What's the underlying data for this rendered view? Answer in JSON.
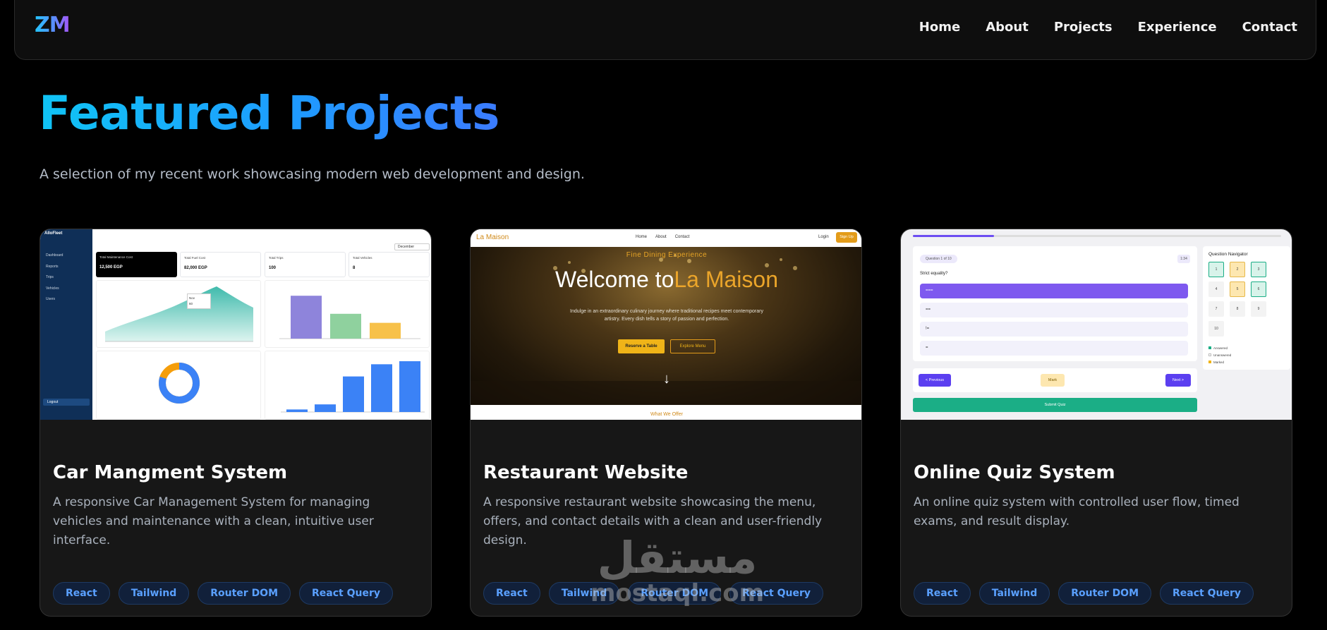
{
  "brand": {
    "logo": "ZM"
  },
  "nav": {
    "items": [
      {
        "label": "Home"
      },
      {
        "label": "About"
      },
      {
        "label": "Projects"
      },
      {
        "label": "Experience"
      },
      {
        "label": "Contact"
      }
    ]
  },
  "header": {
    "title": "Featured Projects",
    "subtitle": "A selection of my recent work showcasing modern web development and design."
  },
  "projects": [
    {
      "title": "Car Mangment System",
      "description": "A responsive Car Management System for managing vehicles and maintenance with a clean, intuitive user interface.",
      "tags": [
        "React",
        "Tailwind",
        "Router DOM",
        "React Query"
      ],
      "preview": {
        "brand": "AlloFleet",
        "sidebar": [
          "Dashboard",
          "Reports",
          "Trips",
          "Vehicles",
          "Users"
        ],
        "logout": "Logout",
        "month": "December",
        "stats": [
          {
            "label": "Total Maintenance Cost",
            "value": "12,500 EGP"
          },
          {
            "label": "Total Fuel Cost",
            "value": "82,000 EGP"
          },
          {
            "label": "Total Trips",
            "value": "100"
          },
          {
            "label": "Total Vehicles",
            "value": "8"
          }
        ],
        "tooltip_title": "Nov",
        "tooltip_value": "60",
        "bar_values": [
          0.95,
          0.55,
          0.35
        ],
        "bar_colors": [
          "#8e84db",
          "#8fd19e",
          "#f7c14a"
        ],
        "column_values": [
          0.05,
          0.15,
          0.7,
          0.94,
          1.0
        ],
        "donut_share": 0.8
      }
    },
    {
      "title": "Restaurant Website",
      "description": "A responsive restaurant website showcasing the menu, offers, and contact details with a clean and user-friendly design.",
      "tags": [
        "React",
        "Tailwind",
        "Router DOM",
        "React Query"
      ],
      "preview": {
        "brand": "La Maison",
        "nav": [
          "Home",
          "About",
          "Contact"
        ],
        "login": "Login",
        "signup": "Sign Up",
        "eyebrow": "Fine Dining Experience",
        "heading_prefix": "Welcome to",
        "heading_highlight": "La Maison",
        "intro": "Indulge in an extraordinary culinary journey where traditional recipes meet contemporary artistry. Every dish tells a story of passion and perfection.",
        "primary_cta": "Reserve a Table",
        "secondary_cta": "Explore Menu",
        "arrow": "↓",
        "footer": "What We Offer"
      }
    },
    {
      "title": "Online Quiz System",
      "description": "An online quiz system with controlled user flow, timed exams, and result display.",
      "tags": [
        "React",
        "Tailwind",
        "Router DOM",
        "React Query"
      ],
      "preview": {
        "progress": 0.22,
        "question_counter": "Question 1 of 10",
        "timer": "1:34",
        "question": "Strict equality?",
        "options": [
          "===",
          "==",
          "!=",
          "="
        ],
        "prev": "< Previous",
        "mark": "Mark",
        "next": "Next >",
        "submit": "Submit Quiz",
        "navigator_title": "Question Navigator",
        "nav_numbers": [
          "1",
          "2",
          "3",
          "4",
          "5",
          "6",
          "7",
          "8",
          "9",
          "10"
        ],
        "legend": [
          "Answered",
          "Unanswered",
          "Marked"
        ]
      }
    }
  ],
  "watermark": {
    "arabic": "مستقل",
    "latin": "mostaql.com"
  }
}
